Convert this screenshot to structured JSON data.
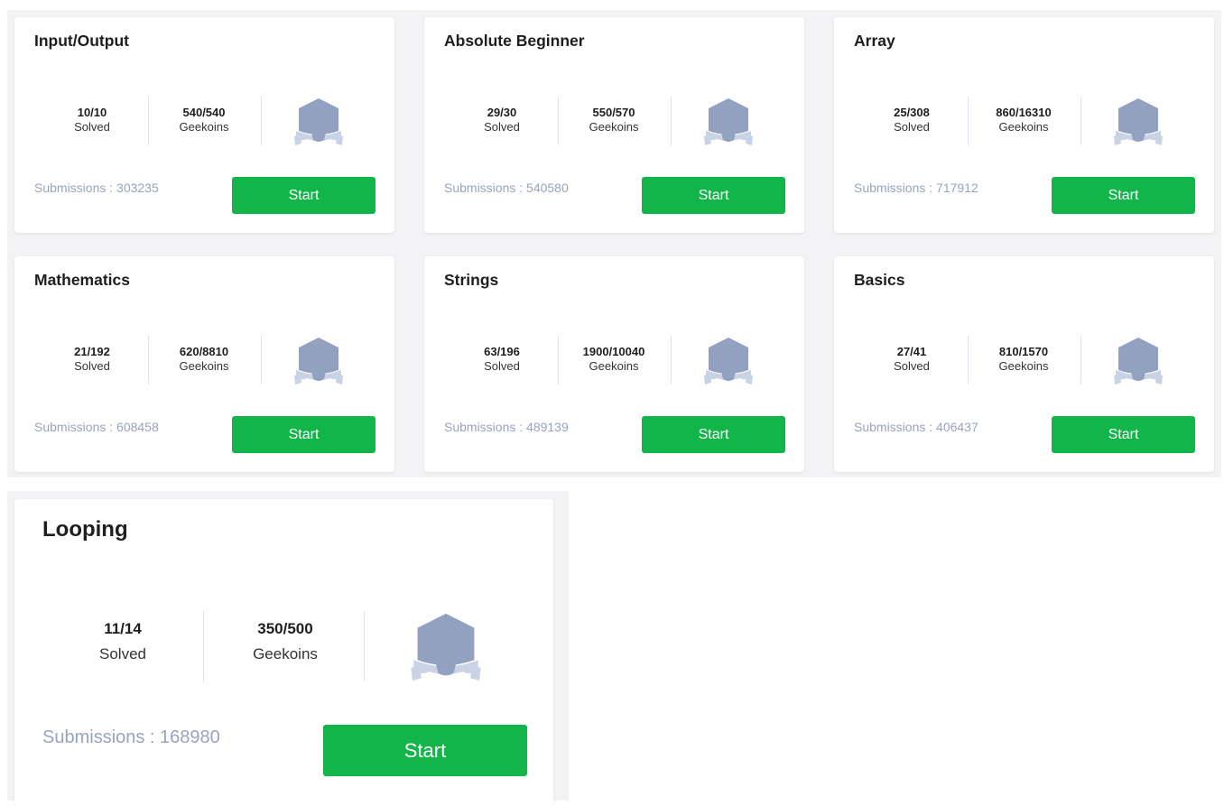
{
  "colors": {
    "accent_green": "#12b54a",
    "muted_text": "#9aa3bd",
    "badge_primary": "#93a1c0",
    "badge_ribbon": "#c9d3e6"
  },
  "labels": {
    "solved": "Solved",
    "geekoins": "Geekoins",
    "start": "Start"
  },
  "courses": [
    {
      "title": "Input/Output",
      "solved": "10/10",
      "geekoins": "540/540",
      "submissions": "Submissions : 303235",
      "badge_icon": "shield-badge-icon"
    },
    {
      "title": "Absolute Beginner",
      "solved": "29/30",
      "geekoins": "550/570",
      "submissions": "Submissions : 540580",
      "badge_icon": "shield-badge-icon"
    },
    {
      "title": "Array",
      "solved": "25/308",
      "geekoins": "860/16310",
      "submissions": "Submissions : 717912",
      "badge_icon": "shield-badge-icon"
    },
    {
      "title": "Mathematics",
      "solved": "21/192",
      "geekoins": "620/8810",
      "submissions": "Submissions : 608458",
      "badge_icon": "shield-badge-icon"
    },
    {
      "title": "Strings",
      "solved": "63/196",
      "geekoins": "1900/10040",
      "submissions": "Submissions : 489139",
      "badge_icon": "shield-badge-icon"
    },
    {
      "title": "Basics",
      "solved": "27/41",
      "geekoins": "810/1570",
      "submissions": "Submissions : 406437",
      "badge_icon": "shield-badge-icon"
    },
    {
      "title": "Looping",
      "solved": "11/14",
      "geekoins": "350/500",
      "submissions": "Submissions : 168980",
      "badge_icon": "shield-badge-icon"
    }
  ]
}
